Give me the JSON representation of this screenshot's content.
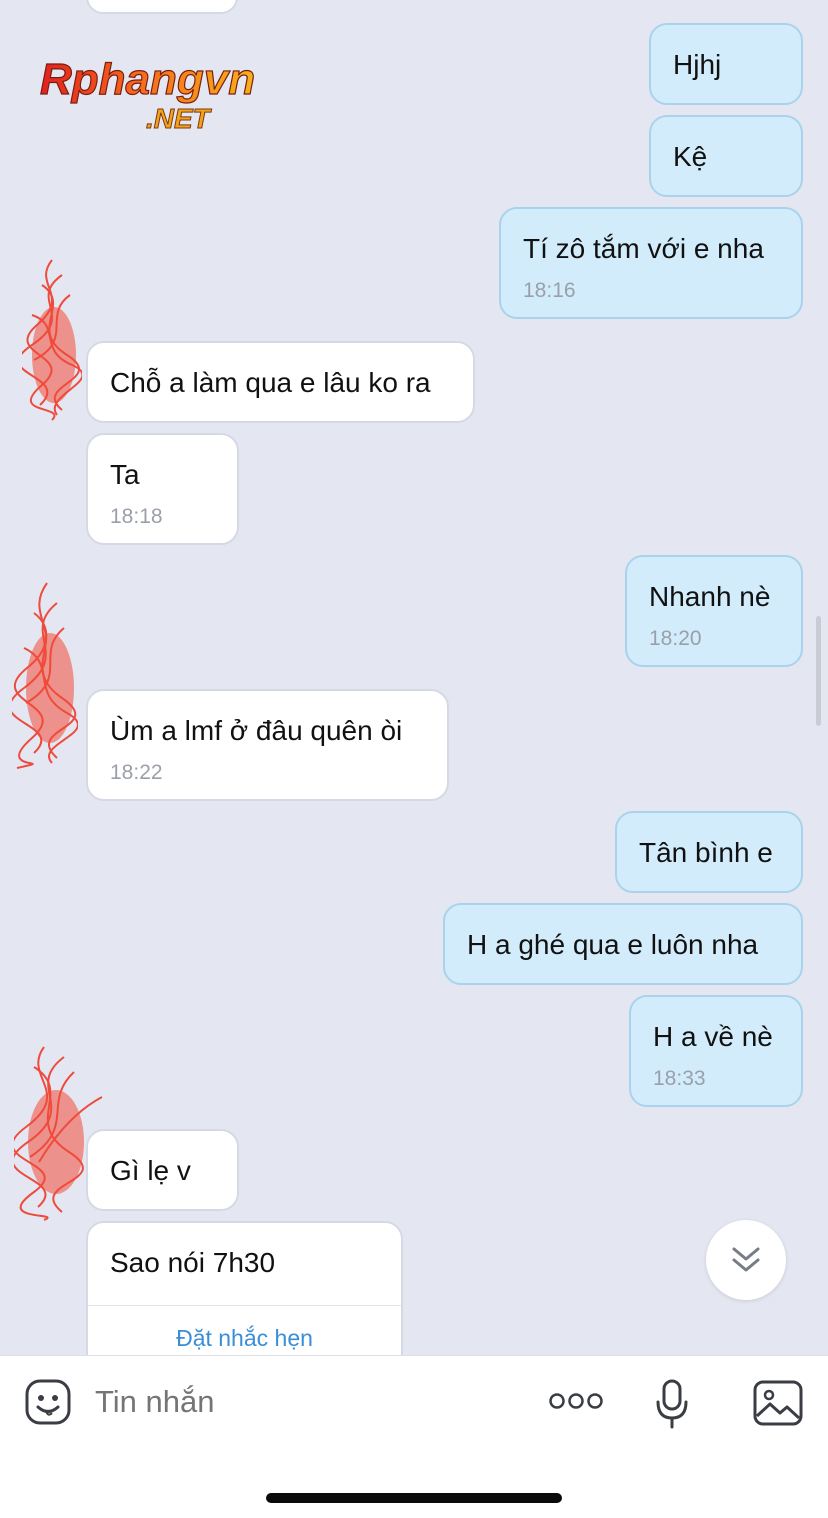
{
  "watermark": {
    "name": "Rphangvn",
    "domain": ".NET"
  },
  "messages": [
    {
      "side": "out",
      "text": "Hjhj",
      "time": ""
    },
    {
      "side": "out",
      "text": "Kệ",
      "time": ""
    },
    {
      "side": "out",
      "text": "Tí zô tắm với e nha",
      "time": "18:16"
    },
    {
      "side": "in",
      "text": "Chỗ a làm qua e lâu ko ra",
      "time": ""
    },
    {
      "side": "in",
      "text": "Ta",
      "time": "18:18"
    },
    {
      "side": "out",
      "text": "Nhanh nè",
      "time": "18:20"
    },
    {
      "side": "in",
      "text": "Ùm a lmf ở đâu quên òi",
      "time": "18:22"
    },
    {
      "side": "out",
      "text": "Tân bình e",
      "time": ""
    },
    {
      "side": "out",
      "text": "H a ghé qua e luôn nha",
      "time": ""
    },
    {
      "side": "out",
      "text": "H a về nè",
      "time": "18:33"
    },
    {
      "side": "in",
      "text": "Gì lẹ v",
      "time": ""
    },
    {
      "side": "in",
      "text": "Sao nói 7h30",
      "time": "",
      "action": "Đặt nhắc hẹn"
    }
  ],
  "composer": {
    "placeholder": "Tin nhắn",
    "icons": [
      "emoji-icon",
      "more-icon",
      "microphone-icon",
      "image-icon"
    ]
  },
  "scroll_button_icon": "double-chevron-down-icon"
}
